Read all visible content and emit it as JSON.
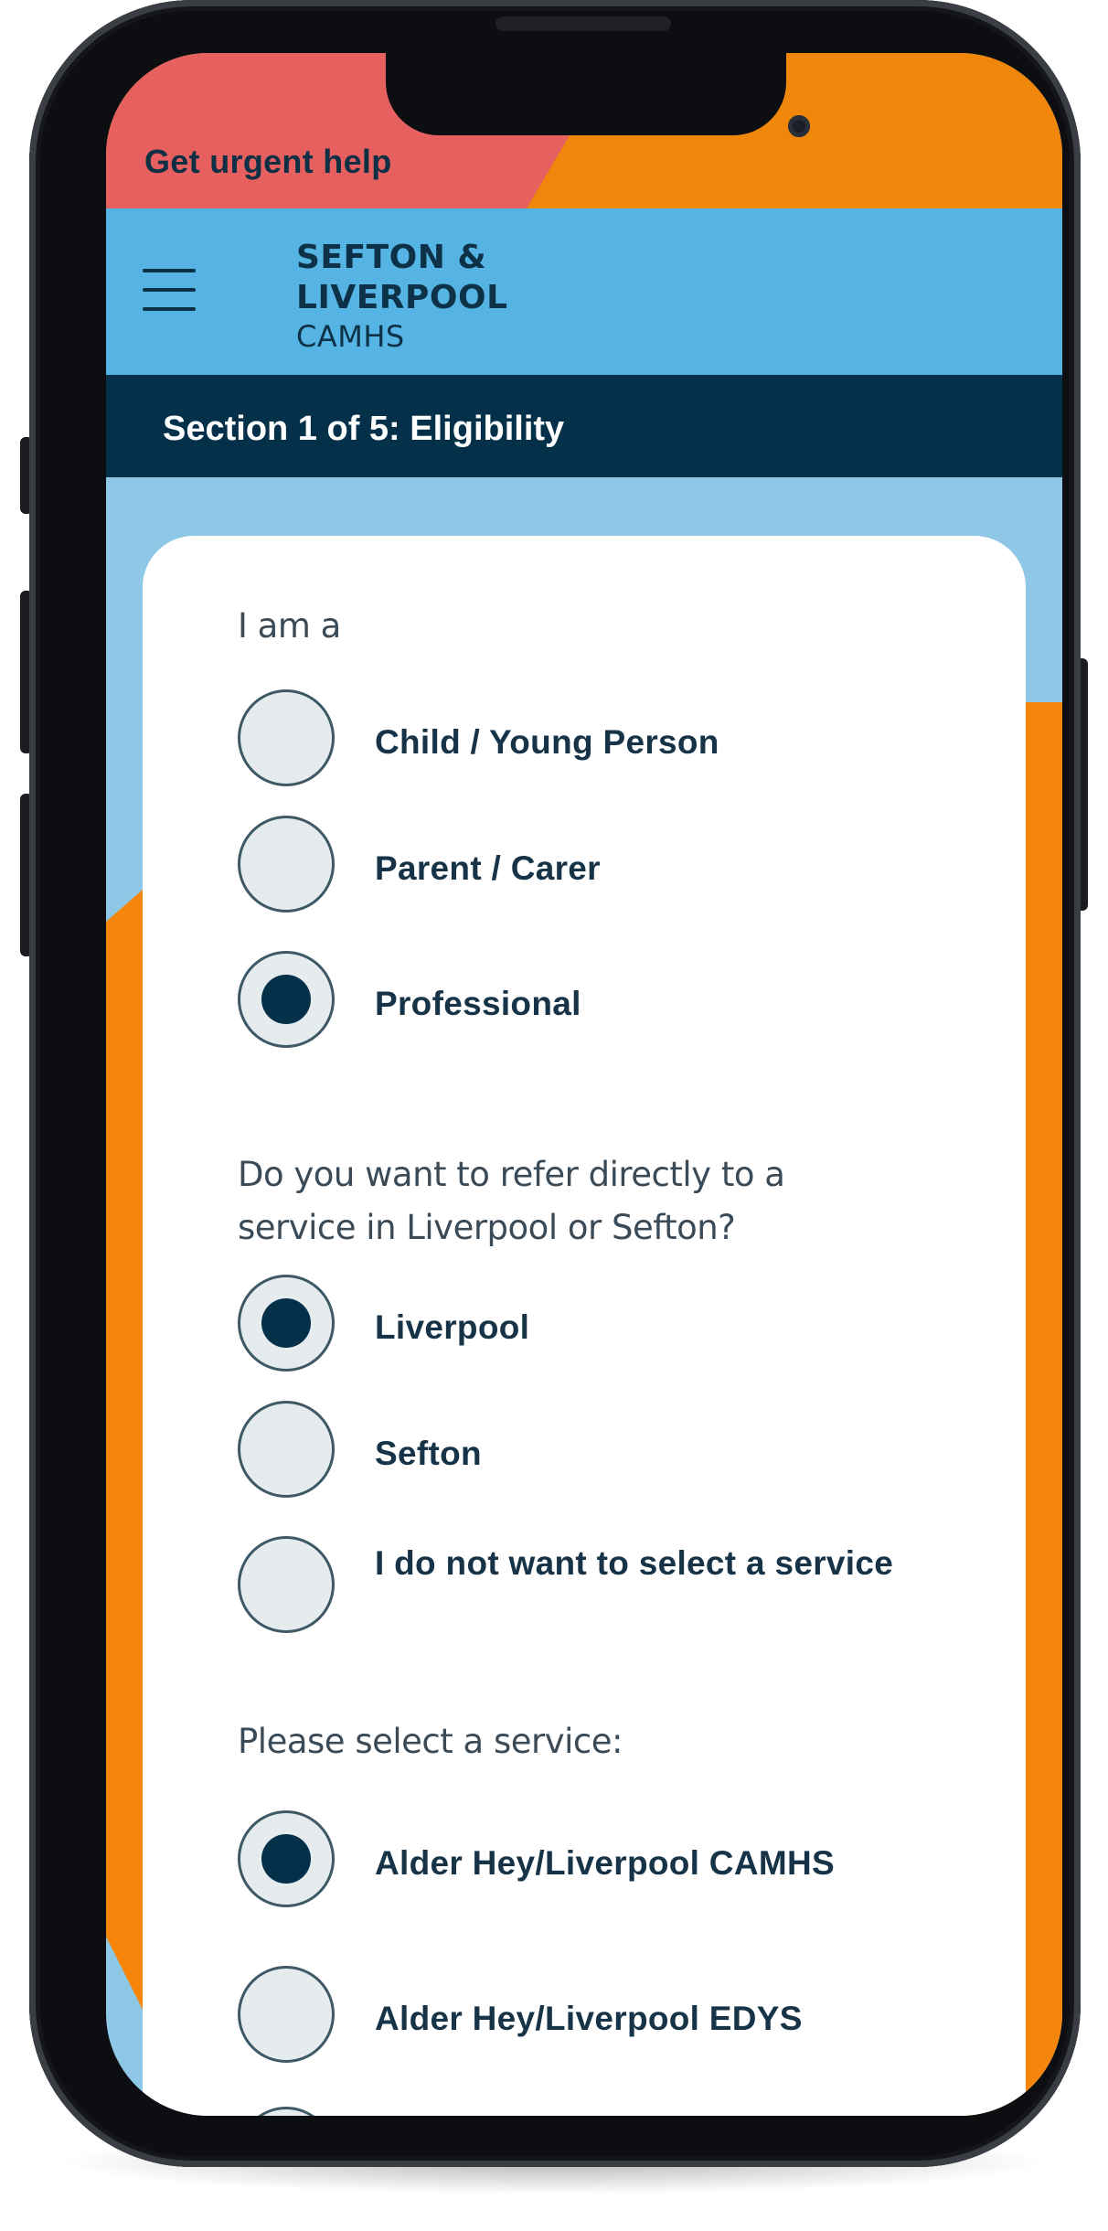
{
  "urgent": {
    "label": "Get urgent help"
  },
  "header": {
    "logo_line1": "SEFTON &",
    "logo_line2": "LIVERPOOL",
    "logo_line3": "CAMHS"
  },
  "section": {
    "title": "Section 1 of 5: Eligibility"
  },
  "form": {
    "q1": {
      "label": "I am a",
      "options": [
        {
          "label": "Child / Young Person",
          "selected": false
        },
        {
          "label": "Parent / Carer",
          "selected": false
        },
        {
          "label": "Professional",
          "selected": true
        }
      ]
    },
    "q2": {
      "label": "Do you want to refer directly to a service in Liverpool or Sefton?",
      "options": [
        {
          "label": "Liverpool",
          "selected": true
        },
        {
          "label": "Sefton",
          "selected": false
        },
        {
          "label": "I do not want to select a service",
          "selected": false
        }
      ]
    },
    "q3": {
      "label": "Please select a service:",
      "options": [
        {
          "label": "Alder Hey/Liverpool CAMHS",
          "selected": true
        },
        {
          "label": "Alder Hey/Liverpool EDYS",
          "selected": false
        }
      ]
    }
  },
  "colors": {
    "urgent_red": "#e66060",
    "urgent_orange": "#f0870a",
    "header_blue": "#55b4e4",
    "section_navy": "#04304a",
    "background_light_blue": "#8ec8e6",
    "accent_orange": "#f5860b"
  }
}
